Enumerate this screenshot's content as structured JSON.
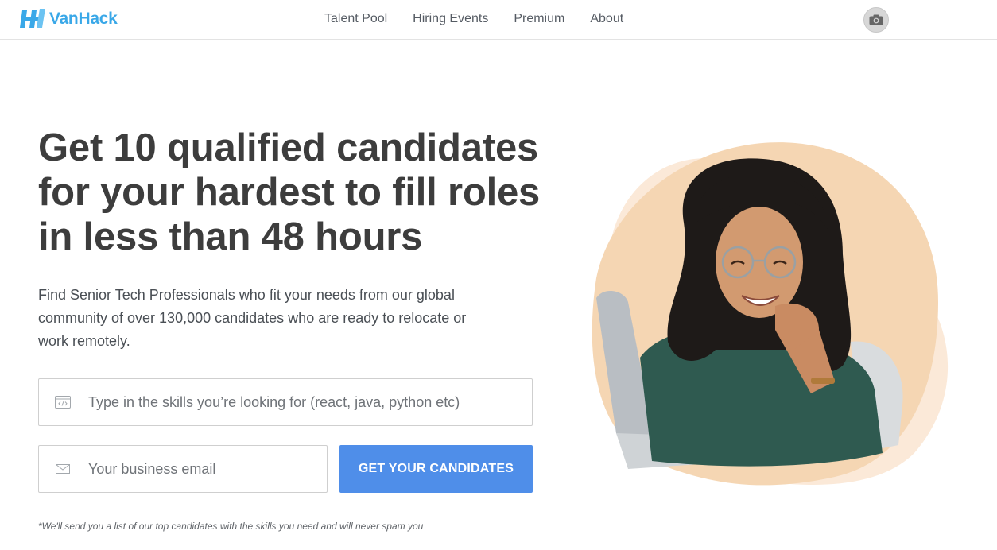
{
  "header": {
    "logo_text": "VanHack",
    "nav": [
      "Talent Pool",
      "Hiring Events",
      "Premium",
      "About"
    ],
    "camera_icon": "camera-icon"
  },
  "hero": {
    "headline_lines": [
      "Get 10 qualified candidates",
      "for your hardest to fill roles",
      "in less than 48 hours"
    ],
    "subtext": "Find Senior Tech Professionals who fit your needs from our global community of over 130,000 candidates who are ready to relocate or work remotely.",
    "skills_placeholder": "Type in the skills you’re looking for (react, java, python etc)",
    "email_placeholder": "Your business email",
    "cta_label": "GET YOUR CANDIDATES",
    "disclaimer": "*We'll send you a list of our top candidates with the skills you need and will never spam you",
    "skills_icon": "code-window-icon",
    "email_icon": "envelope-icon",
    "image": "smiling-developer-photo"
  },
  "colors": {
    "brand": "#3aa8e8",
    "cta": "#4f8ee9",
    "blob_main": "#f5d6b3",
    "blob_back": "#fbe9d8"
  }
}
